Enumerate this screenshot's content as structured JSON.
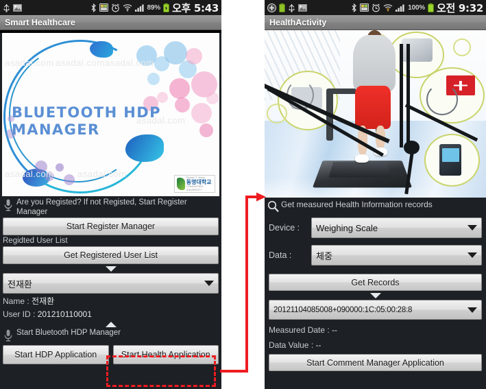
{
  "left_phone": {
    "status_bar": {
      "left_icons": [
        "usb-icon",
        "image-icon"
      ],
      "right_icons": [
        "bluetooth-icon",
        "sd-card-icon",
        "alarm-icon",
        "wifi-icon",
        "signal-icon"
      ],
      "battery_percent": "89%",
      "battery_icon": "battery-charging-icon",
      "clock": "오후 5:43"
    },
    "title": "Smart Healthcare",
    "banner": {
      "name": "bluetooth-hdp-manager-splash",
      "title_line1": "BLUETOOTH HDP",
      "title_line2": "MANAGER",
      "watermarks": [
        "asadal.com",
        "asadal.com",
        "asadal.com",
        "asadal.com",
        "asadal.com",
        "asadal.com"
      ],
      "logo_kr": "동명대학교",
      "logo_en": "TONGMYONG UNIVERSITY",
      "logo_tag": "Global IT Vision"
    },
    "hint_register": "Are you Registed? If not Registed, Start Register Manager",
    "btn_start_register_manager": "Start Register Manager",
    "label_user_list": "Regidted User List",
    "btn_get_registered_user_list": "Get Registered User List",
    "spinner_user": "전재환",
    "name_label": "Name :",
    "name_value": "전재환",
    "userid_label": "User ID :",
    "userid_value": "201210110001",
    "hint_start_bt": "Start Bluetooth HDP Manager",
    "btn_start_hdp_application": "Start HDP Application",
    "btn_start_health_application": "Start Health Application"
  },
  "right_phone": {
    "status_bar": {
      "left_icons": [
        "add-icon",
        "battery-green-icon",
        "usb-icon",
        "image-icon"
      ],
      "right_icons": [
        "bluetooth-icon",
        "sd-card-icon",
        "alarm-icon",
        "wifi-icon",
        "signal-icon"
      ],
      "battery_percent": "100%",
      "battery_icon": "battery-full-icon",
      "clock": "오전 9:32"
    },
    "title": "HealthActivity",
    "banner": {
      "name": "treadmill-health-devices-image"
    },
    "hint_records": "Get measured Health Information records",
    "device_label": "Device :",
    "device_value": "Weighing Scale",
    "data_label": "Data :",
    "data_value": "체중",
    "btn_get_records": "Get Records",
    "spinner_record": "20121104085008+090000:1C:05:00:28:8",
    "measured_date_label": "Measured Date :",
    "measured_date_value": "--",
    "data_value_label": "Data Value :",
    "data_value_value": "--",
    "btn_start_comment_manager": "Start Comment Manager Application"
  },
  "annotation": {
    "highlight_color": "#ee1c21",
    "arrow_name": "flow-arrow-to-health-activity",
    "dashed_box_name": "highlight-start-health-application"
  }
}
